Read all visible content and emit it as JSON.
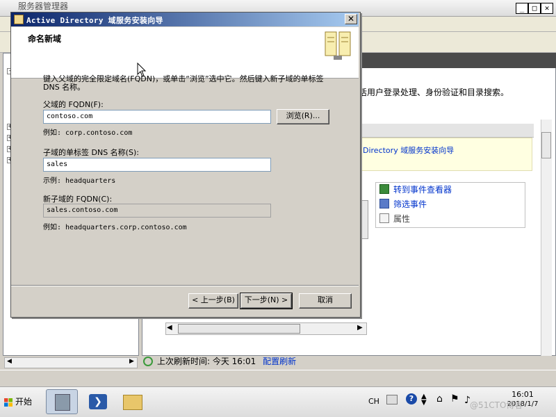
{
  "background_window": {
    "title": "服务器管理器",
    "description": "活用户登录处理、身份验证和目录搜索。",
    "notice_link": "Directory 域服务安装向导",
    "actions": [
      {
        "icon": "event-viewer-icon",
        "label": "转到事件查看器"
      },
      {
        "icon": "filter-icon",
        "label": "筛选事件"
      },
      {
        "icon": "properties-icon",
        "label": "属性"
      }
    ],
    "refresh_label": "上次刷新时间: 今天 16:01",
    "refresh_link": "配置刷新"
  },
  "wizard": {
    "title": "Active Directory 域服务安装向导",
    "heading": "命名新域",
    "instruction": "键入父域的完全限定域名(FQDN)，或单击“浏览”选中它。然后键入新子域的单标签 DNS 名称。",
    "parent_label": "父域的 FQDN(F):",
    "parent_value": "contoso.com",
    "browse_label": "浏览(R)...",
    "parent_example": "例如: corp.contoso.com",
    "child_label": "子域的单标签 DNS 名称(S):",
    "child_value": "sales",
    "child_example": "示例: headquarters",
    "fqdn_label": "新子域的 FQDN(C):",
    "fqdn_value": "sales.contoso.com",
    "fqdn_example": "例如: headquarters.corp.contoso.com",
    "back_label": "< 上一步(B)",
    "next_label": "下一步(N) >",
    "cancel_label": "取消"
  },
  "taskbar": {
    "start_label": "开始",
    "lang": "CH",
    "clock_time": "16:01",
    "clock_date": "2018/1/7",
    "watermark": "@51CTO博客"
  },
  "colors": {
    "title_active": "#0a246a",
    "title_fade": "#a6caf0",
    "link": "#0033cc",
    "notice_bg": "#ffffe1"
  }
}
